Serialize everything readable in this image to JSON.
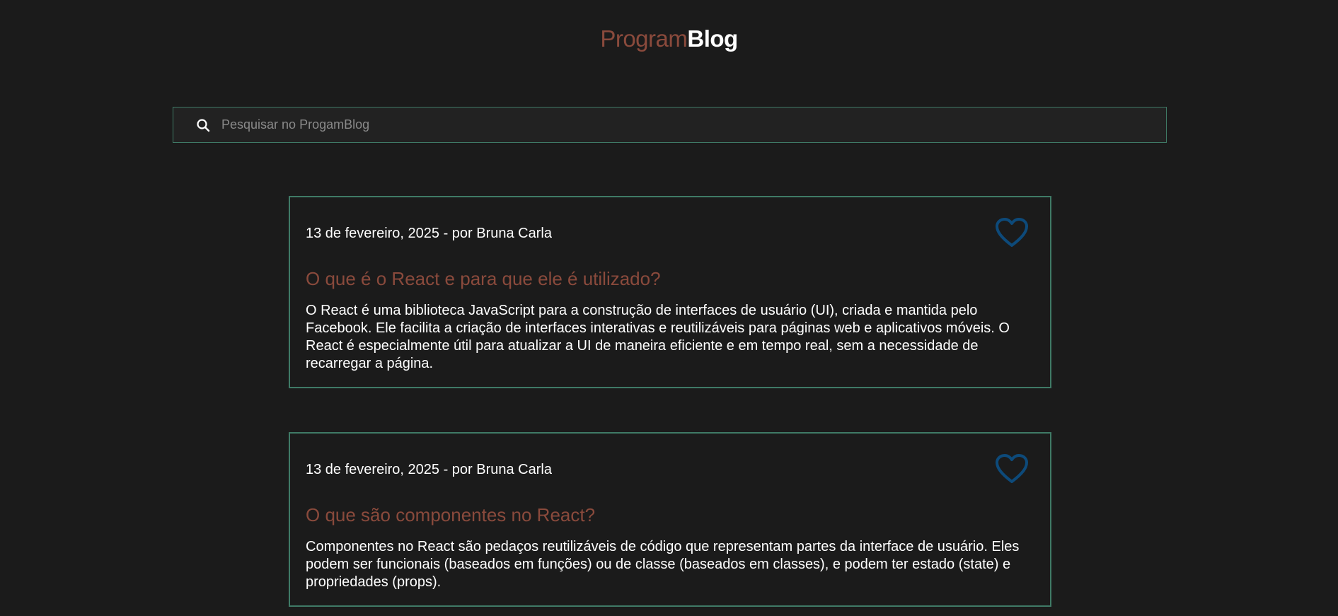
{
  "header": {
    "logo_part1": "Program",
    "logo_part2": "Blog"
  },
  "search": {
    "placeholder": "Pesquisar no ProgamBlog",
    "value": "",
    "icon": "search-icon"
  },
  "posts": [
    {
      "meta": "13 de fevereiro, 2025 - por Bruna Carla",
      "title": "O que é o React e para que ele é utilizado?",
      "body": "O React é uma biblioteca JavaScript para a construção de interfaces de usuário (UI), criada e mantida pelo Facebook. Ele facilita a criação de interfaces interativas e reutilizáveis para páginas web e aplicativos móveis. O React é especialmente útil para atualizar a UI de maneira eficiente e em tempo real, sem a necessidade de recarregar a página.",
      "icon": "heart-icon"
    },
    {
      "meta": "13 de fevereiro, 2025 - por Bruna Carla",
      "title": "O que são componentes no React?",
      "body": "Componentes no React são pedaços reutilizáveis de código que representam partes da interface de usuário. Eles podem ser funcionais (baseados em funções) ou de classe (baseados em classes), e podem ter estado (state) e propriedades (props).",
      "icon": "heart-icon"
    }
  ],
  "colors": {
    "background": "#1b1b1b",
    "accent_title": "#8a4a3c",
    "border": "#3f7a66",
    "heart": "#0d4a7a"
  }
}
